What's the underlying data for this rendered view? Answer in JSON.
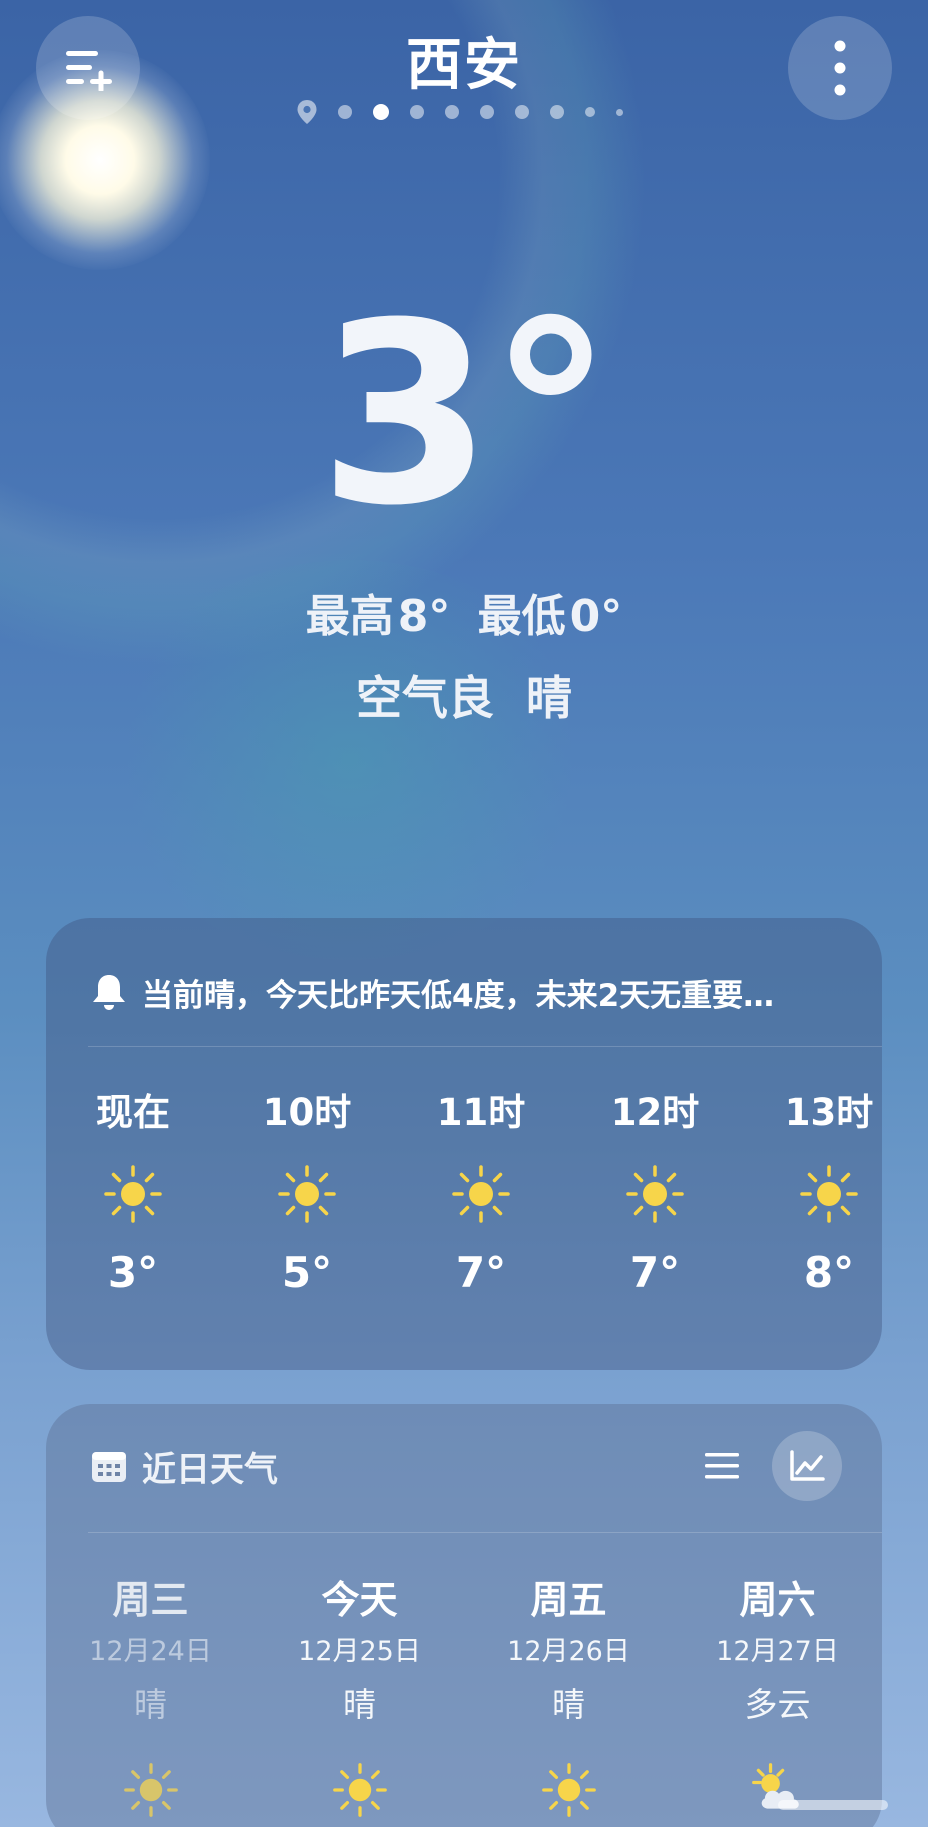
{
  "header": {
    "city": "西安",
    "menu_icon": "list-add-icon",
    "more_icon": "vertical-dots-icon",
    "page_count": 9,
    "active_page": 2
  },
  "current": {
    "temperature": "3°",
    "high_label": "最高",
    "high": "8°",
    "low_label": "最低",
    "low": "0°",
    "air_quality": "空气良",
    "condition": "晴"
  },
  "hourly_card": {
    "alert_icon": "bell-icon",
    "alert_text": "当前晴，今天比昨天低4度，未来2天无重要…",
    "hours": [
      {
        "label": "现在",
        "icon": "sun-icon",
        "temp": "3°"
      },
      {
        "label": "10时",
        "icon": "sun-icon",
        "temp": "5°"
      },
      {
        "label": "11时",
        "icon": "sun-icon",
        "temp": "7°"
      },
      {
        "label": "12时",
        "icon": "sun-icon",
        "temp": "7°"
      },
      {
        "label": "13时",
        "icon": "sun-icon",
        "temp": "8°"
      }
    ]
  },
  "daily_card": {
    "title_icon": "calendar-icon",
    "title": "近日天气",
    "list_view_icon": "list-view-icon",
    "chart_view_icon": "line-chart-icon",
    "days": [
      {
        "name": "周三",
        "date": "12月24日",
        "condition": "晴",
        "icon": "sun-icon"
      },
      {
        "name": "今天",
        "date": "12月25日",
        "condition": "晴",
        "icon": "sun-icon"
      },
      {
        "name": "周五",
        "date": "12月26日",
        "condition": "晴",
        "icon": "sun-icon"
      },
      {
        "name": "周六",
        "date": "12月27日",
        "condition": "多云",
        "icon": "partly-cloudy-icon"
      }
    ]
  },
  "colors": {
    "sun": "#f7d54a",
    "sun_dim": "#d8c56a"
  }
}
